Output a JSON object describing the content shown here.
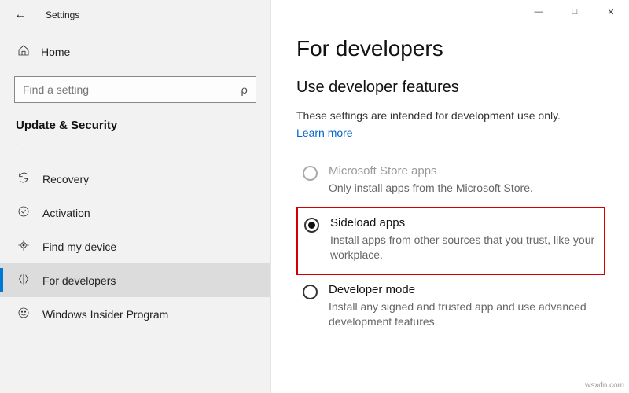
{
  "titlebar": {
    "app": "Settings"
  },
  "sidebar": {
    "home": "Home",
    "search_placeholder": "Find a setting",
    "category": "Update & Security",
    "items": [
      {
        "label": "Recovery"
      },
      {
        "label": "Activation"
      },
      {
        "label": "Find my device"
      },
      {
        "label": "For developers"
      },
      {
        "label": "Windows Insider Program"
      }
    ]
  },
  "content": {
    "heading": "For developers",
    "subheading": "Use developer features",
    "intro": "These settings are intended for development use only.",
    "learn_more": "Learn more",
    "options": [
      {
        "title": "Microsoft Store apps",
        "desc": "Only install apps from the Microsoft Store.",
        "state": "disabled"
      },
      {
        "title": "Sideload apps",
        "desc": "Install apps from other sources that you trust, like your workplace.",
        "state": "checked"
      },
      {
        "title": "Developer mode",
        "desc": "Install any signed and trusted app and use advanced development features.",
        "state": "unchecked"
      }
    ]
  },
  "watermark": "wsxdn.com"
}
